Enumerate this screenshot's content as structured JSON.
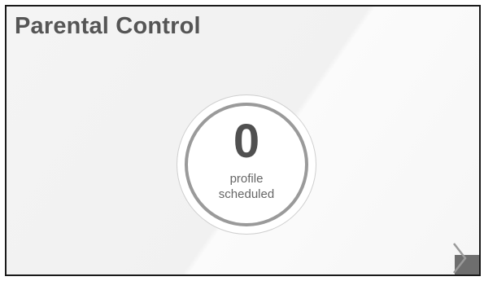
{
  "widget": {
    "title": "Parental Control",
    "count": "0",
    "caption_line1": "profile",
    "caption_line2": "scheduled",
    "more_icon": "chevron-right-icon"
  },
  "colors": {
    "title": "#555555",
    "ring": "#9a9a9a",
    "button": "#6e6e6e"
  }
}
